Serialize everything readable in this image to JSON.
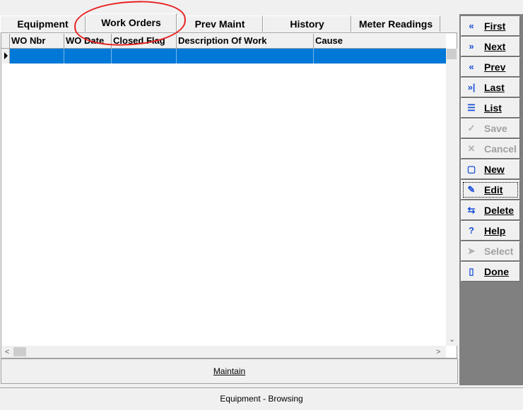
{
  "tabs": [
    {
      "label": "Equipment",
      "active": false
    },
    {
      "label": "Work Orders",
      "active": true
    },
    {
      "label": "Prev Maint",
      "active": false
    },
    {
      "label": "History",
      "active": false
    },
    {
      "label": "Meter Readings",
      "active": false
    }
  ],
  "grid": {
    "columns": [
      "WO Nbr",
      "WO Date",
      "Closed Flag",
      "Description Of Work",
      "Cause"
    ],
    "rows": [
      [
        "",
        "",
        "",
        "",
        ""
      ]
    ],
    "selected_row": 0
  },
  "maintain_label": "Maintain",
  "panel": {
    "buttons": [
      {
        "label": "First",
        "icon": "double-left-chevron-icon",
        "glyph": "«",
        "enabled": true
      },
      {
        "label": "Next",
        "icon": "double-right-chevron-icon",
        "glyph": "»",
        "enabled": true
      },
      {
        "label": "Prev",
        "icon": "double-left-chevron-icon",
        "glyph": "«",
        "enabled": true
      },
      {
        "label": "Last",
        "icon": "double-right-bar-icon",
        "glyph": "»|",
        "enabled": true
      },
      {
        "label": "List",
        "icon": "list-icon",
        "glyph": "☰",
        "enabled": true
      },
      {
        "label": "Save",
        "icon": "checkmark-icon",
        "glyph": "✓",
        "enabled": false
      },
      {
        "label": "Cancel",
        "icon": "x-icon",
        "glyph": "✕",
        "enabled": false
      },
      {
        "label": "New",
        "icon": "new-document-icon",
        "glyph": "▢",
        "enabled": true
      },
      {
        "label": "Edit",
        "icon": "edit-document-icon",
        "glyph": "✎",
        "enabled": true
      },
      {
        "label": "Delete",
        "icon": "delete-icon",
        "glyph": "⇆",
        "enabled": true
      },
      {
        "label": "Help",
        "icon": "question-mark-icon",
        "glyph": "?",
        "enabled": true
      },
      {
        "label": "Select",
        "icon": "select-icon",
        "glyph": "➤",
        "enabled": false
      },
      {
        "label": "Done",
        "icon": "door-exit-icon",
        "glyph": "▯",
        "enabled": true
      }
    ],
    "focused": "Edit"
  },
  "status_text": "Equipment - Browsing",
  "colors": {
    "selection": "#0078d7",
    "annotation": "#e82020",
    "panel_background": "#808080",
    "icon_blue": "#1a4fd6"
  }
}
